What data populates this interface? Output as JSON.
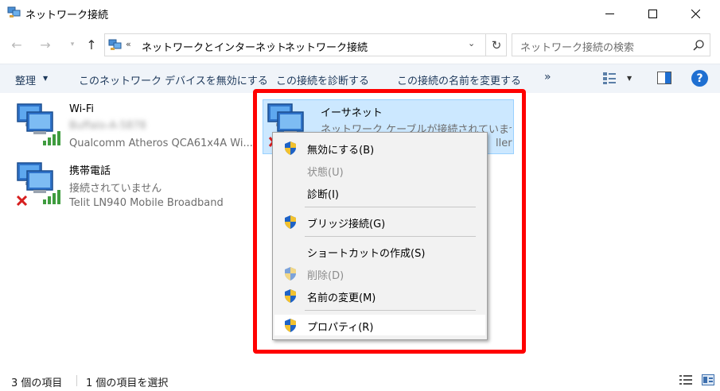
{
  "window": {
    "title": "ネットワーク接続",
    "minimize_glyph": "—",
    "maximize_glyph": "☐",
    "close_glyph": "✕"
  },
  "nav": {
    "back_glyph": "←",
    "forward_glyph": "→",
    "recent_glyph": "▾",
    "up_glyph": "↑",
    "breadcrumb_prefix": "«",
    "breadcrumb": [
      "ネットワークとインターネット",
      "ネットワーク接続"
    ],
    "breadcrumb_separator": "›",
    "dropdown_glyph": "⌄",
    "refresh_glyph": "↻",
    "search_placeholder": "ネットワーク接続の検索"
  },
  "commandbar": {
    "organize": "整理",
    "organize_arrow": "▼",
    "commands": [
      "このネットワーク デバイスを無効にする",
      "この接続を診断する",
      "この接続の名前を変更する"
    ],
    "more": "»",
    "view_dropdown": "▼",
    "help": "?"
  },
  "connections": [
    {
      "name": "Wi-Fi",
      "status": "Buffalo-A-5878",
      "status_obscured": true,
      "device": "Qualcomm Atheros QCA61x4A Wi...",
      "icon": "wifi-signal-icon"
    },
    {
      "name": "携帯電話",
      "status": "接続されていません",
      "device": "Telit LN940 Mobile Broadband",
      "icon": "cellular-disconnected-icon"
    },
    {
      "name": "イーサネット",
      "status": "ネットワーク ケーブルが接続されていませ...",
      "device_visible_suffix": "ller",
      "icon": "ethernet-disconnected-icon",
      "selected": true
    }
  ],
  "context_menu": {
    "items": [
      {
        "label": "無効にする(B)",
        "shield": true,
        "disabled": false
      },
      {
        "label": "状態(U)",
        "shield": false,
        "disabled": true
      },
      {
        "label": "診断(I)",
        "shield": false,
        "disabled": false
      },
      {
        "label": "ブリッジ接続(G)",
        "shield": true,
        "disabled": false
      },
      {
        "label": "ショートカットの作成(S)",
        "shield": false,
        "disabled": false
      },
      {
        "label": "削除(D)",
        "shield": true,
        "disabled": true
      },
      {
        "label": "名前の変更(M)",
        "shield": true,
        "disabled": false
      },
      {
        "label": "プロパティ(R)",
        "shield": true,
        "disabled": false,
        "hovered": true
      }
    ]
  },
  "statusbar": {
    "item_count": "3 個の項目",
    "selected_count": "1 個の項目を選択"
  },
  "colors": {
    "highlight_border": "#ff0000",
    "selection_bg": "#cce8ff",
    "command_text": "#1e395b",
    "help_blue": "#1f6fd1"
  }
}
